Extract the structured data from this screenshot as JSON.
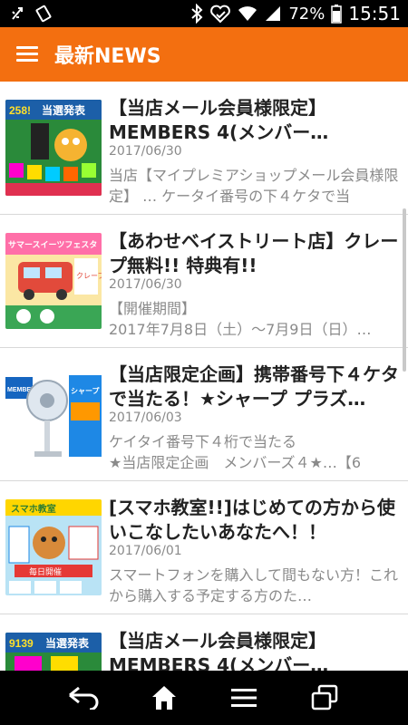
{
  "status_bar": {
    "battery_percent": "72%",
    "time": "15:51",
    "icons": [
      "usb-icon",
      "silent-icon",
      "bluetooth-icon",
      "heart-icon",
      "wifi-icon",
      "signal-icon",
      "battery-icon"
    ]
  },
  "app_bar": {
    "title": "最新NEWS",
    "menu_icon": "hamburger-icon",
    "background": "#f36f10"
  },
  "news": [
    {
      "title": "【当店メール会員様限定】MEMBERS 4(メンバー…",
      "date": "2017/06/30",
      "description": "当店【マイプレミアショップメール会員様限定】 … ケータイ番号の下４ケタで当",
      "thumb": {
        "top_text": "258!",
        "caption": "当選発表"
      }
    },
    {
      "title": "【あわせベイストリート店】クレープ無料!! 特典有!!",
      "date": "2017/06/30",
      "description": "【開催期間】\n2017年7月8日（土）〜7月9日（日）…",
      "thumb": {
        "top_text": "サマースイーツフェスタ",
        "caption": "クレープ"
      }
    },
    {
      "title": "【当店限定企画】携帯番号下４ケタで当たる！★シャープ プラズ…",
      "date": "2017/06/03",
      "description": "ケイタイ番号下４桁で当たる\n★当店限定企画　メンバーズ４★…【6",
      "thumb": {
        "top_text": "MEMBERS 4",
        "caption": "シャープ"
      }
    },
    {
      "title": "[スマホ教室!!]はじめての方から使いこなしたいあなたへ！！",
      "date": "2017/06/01",
      "description": "スマートフォンを購入して間もない方！これから購入する予定する方のた…",
      "thumb": {
        "top_text": "スマホ教室",
        "caption": "毎日開催"
      }
    },
    {
      "title": "【当店メール会員様限定】MEMBERS 4(メンバー…",
      "date": "",
      "description": "",
      "thumb": {
        "top_text": "9139",
        "caption": "当選発表"
      }
    }
  ],
  "nav_bar": {
    "icons": [
      "back-icon",
      "home-icon",
      "menu-lines-icon",
      "recent-apps-icon"
    ]
  }
}
